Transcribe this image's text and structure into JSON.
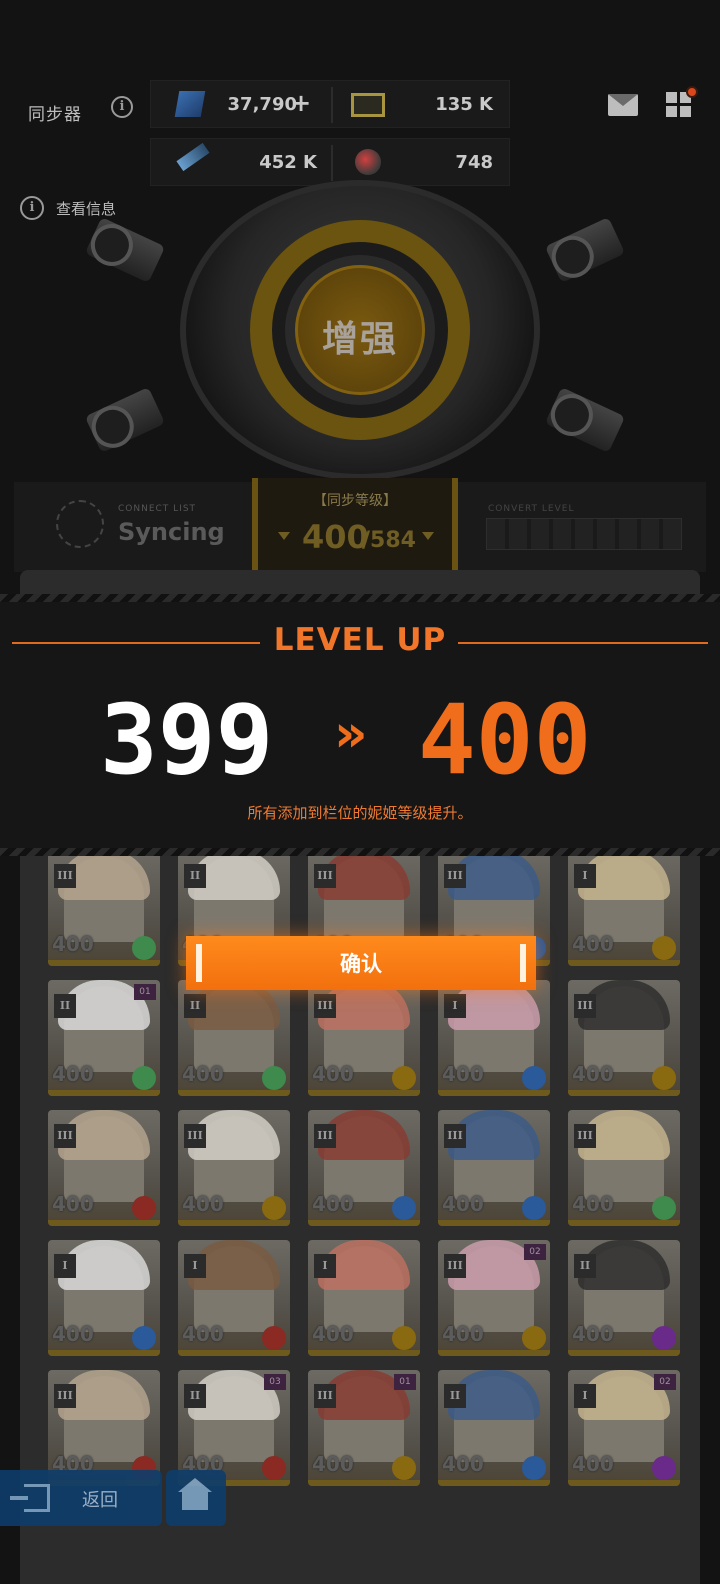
{
  "header": {
    "title": "同步器",
    "view_info_label": "查看信息"
  },
  "resources": [
    {
      "icon": "gem-crystal-icon",
      "value": "37,790",
      "has_add": true,
      "add_label": "+"
    },
    {
      "icon": "battery-credit-icon",
      "value": "135 K"
    },
    {
      "icon": "test-tube-icon",
      "value": "452 K"
    },
    {
      "icon": "core-orb-icon",
      "value": "748"
    }
  ],
  "machine": {
    "enhance_label": "增强"
  },
  "sync": {
    "connect_sub": "CONNECT LIST",
    "status": "Syncing",
    "level_label": "【同步等级】",
    "level_current": "400",
    "level_max": "/584",
    "convert_sub": "CONVERT LEVEL"
  },
  "level_up": {
    "title": "LEVEL UP",
    "from": "399",
    "arrow": "»",
    "to": "400",
    "description": "所有添加到栏位的妮姬等级提升。"
  },
  "confirm_label": "确认",
  "cards": [
    {
      "rank": "III",
      "level": "400",
      "element": "wind",
      "tag": ""
    },
    {
      "rank": "II",
      "level": "400",
      "element": "iron",
      "tag": ""
    },
    {
      "rank": "III",
      "level": "400",
      "element": "fire",
      "tag": ""
    },
    {
      "rank": "III",
      "level": "400",
      "element": "water",
      "tag": ""
    },
    {
      "rank": "I",
      "level": "400",
      "element": "iron",
      "tag": ""
    },
    {
      "rank": "II",
      "level": "400",
      "element": "wind",
      "tag": "01"
    },
    {
      "rank": "II",
      "level": "400",
      "element": "wind",
      "tag": ""
    },
    {
      "rank": "III",
      "level": "400",
      "element": "iron",
      "tag": ""
    },
    {
      "rank": "I",
      "level": "400",
      "element": "water",
      "tag": ""
    },
    {
      "rank": "III",
      "level": "400",
      "element": "iron",
      "tag": ""
    },
    {
      "rank": "III",
      "level": "400",
      "element": "fire",
      "tag": ""
    },
    {
      "rank": "III",
      "level": "400",
      "element": "iron",
      "tag": ""
    },
    {
      "rank": "III",
      "level": "400",
      "element": "water",
      "tag": ""
    },
    {
      "rank": "III",
      "level": "400",
      "element": "water",
      "tag": ""
    },
    {
      "rank": "III",
      "level": "400",
      "element": "wind",
      "tag": ""
    },
    {
      "rank": "I",
      "level": "400",
      "element": "water",
      "tag": ""
    },
    {
      "rank": "I",
      "level": "400",
      "element": "fire",
      "tag": ""
    },
    {
      "rank": "I",
      "level": "400",
      "element": "iron",
      "tag": ""
    },
    {
      "rank": "III",
      "level": "400",
      "element": "iron",
      "tag": "02"
    },
    {
      "rank": "II",
      "level": "400",
      "element": "electric",
      "tag": ""
    },
    {
      "rank": "III",
      "level": "400",
      "element": "fire",
      "tag": ""
    },
    {
      "rank": "II",
      "level": "400",
      "element": "fire",
      "tag": "03"
    },
    {
      "rank": "III",
      "level": "400",
      "element": "iron",
      "tag": "01"
    },
    {
      "rank": "II",
      "level": "400",
      "element": "water",
      "tag": ""
    },
    {
      "rank": "I",
      "level": "400",
      "element": "electric",
      "tag": "02"
    }
  ],
  "element_colors": {
    "wind": "#3f8a4d",
    "iron": "#8a6a10",
    "fire": "#8a2a22",
    "water": "#2a5a9a",
    "electric": "#6a2a8a"
  },
  "nav": {
    "back_label": "返回"
  }
}
